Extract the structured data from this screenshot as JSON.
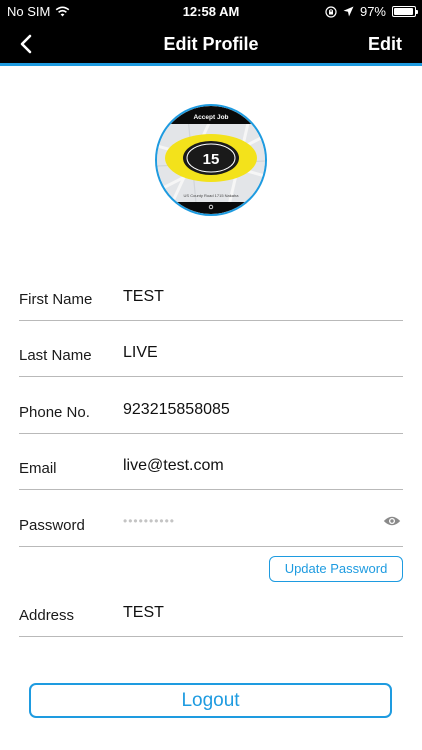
{
  "status_bar": {
    "carrier": "No SIM",
    "time": "12:58 AM",
    "battery": "97%",
    "battery_level": 0.97
  },
  "nav": {
    "title": "Edit Profile",
    "edit_label": "Edit"
  },
  "avatar": {
    "header_text": "Accept Job",
    "number": "15",
    "footer_text": "US County Road 1715 Nakaha"
  },
  "fields": {
    "first_name": {
      "label": "First Name",
      "value": "TEST"
    },
    "last_name": {
      "label": "Last Name",
      "value": "LIVE"
    },
    "phone": {
      "label": "Phone No.",
      "value": "923215858085"
    },
    "email": {
      "label": "Email",
      "value": "live@test.com"
    },
    "password": {
      "label": "Password",
      "value": "••••••••••"
    },
    "address": {
      "label": "Address",
      "value": "TEST"
    }
  },
  "buttons": {
    "update_password": "Update Password",
    "logout": "Logout"
  },
  "colors": {
    "accent": "#1e9be0",
    "bar_background": "#000000",
    "badge_yellow": "#f3e21b"
  },
  "icons": {
    "back": "chevron-left-icon",
    "show_password": "eye-icon",
    "wifi": "wifi-icon",
    "location": "location-arrow-icon",
    "rotation_lock": "rotation-lock-icon",
    "battery": "battery-icon"
  }
}
